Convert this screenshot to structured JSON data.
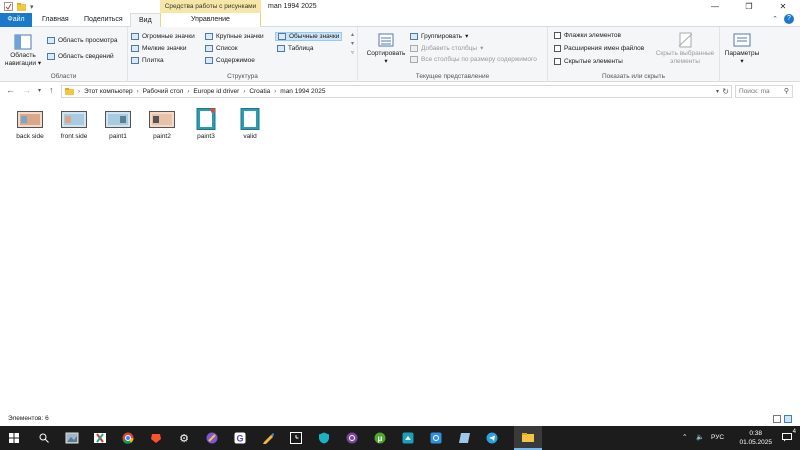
{
  "titlebar": {
    "context_tab": "Средства работы с рисунками",
    "window_title": "man 1994 2025",
    "buttons": [
      "—",
      "❐",
      "✕"
    ]
  },
  "tabs": {
    "file": "Файл",
    "home": "Главная",
    "share": "Поделиться",
    "view": "Вид",
    "manage": "Управление"
  },
  "ribbon": {
    "panes": {
      "label": "Области",
      "nav_pane": "Область навигации",
      "preview_pane": "Область просмотра",
      "details_pane": "Область сведений"
    },
    "layout": {
      "label": "Структура",
      "huge_icons": "Огромные значки",
      "large_icons": "Крупные значки",
      "medium_icons": "Обычные значки",
      "small_icons": "Мелкие значки",
      "list": "Список",
      "table": "Таблица",
      "tiles": "Плитка",
      "content": "Содержимое"
    },
    "current_view": {
      "label": "Текущее представление",
      "sort": "Сортировать",
      "group": "Группировать",
      "add_columns": "Добавить столбцы",
      "fit_columns": "Все столбцы по размеру содержимого"
    },
    "show_hide": {
      "label": "Показать или скрыть",
      "item_checkboxes": "Флажки элементов",
      "file_extensions": "Расширения имен файлов",
      "hidden_items": "Скрытые элементы",
      "hide_selected": "Скрыть выбранные элементы"
    },
    "options": "Параметры"
  },
  "address": {
    "breadcrumbs": [
      "Этот компьютер",
      "Рабочий стол",
      "Europe id driver",
      "Croatia",
      "man 1994 2025"
    ],
    "search_placeholder": "Поиск: ma"
  },
  "files": [
    {
      "name": "back side",
      "kind": "image"
    },
    {
      "name": "front side",
      "kind": "image"
    },
    {
      "name": "paint1",
      "kind": "image"
    },
    {
      "name": "paint2",
      "kind": "image"
    },
    {
      "name": "paint3",
      "kind": "doc"
    },
    {
      "name": "valid",
      "kind": "doc"
    }
  ],
  "status": {
    "items_count": "Элементов: 6"
  },
  "taskbar": {
    "lang": "РУС",
    "time": "0:38",
    "date": "01.05.2025",
    "notification_count": "4"
  }
}
